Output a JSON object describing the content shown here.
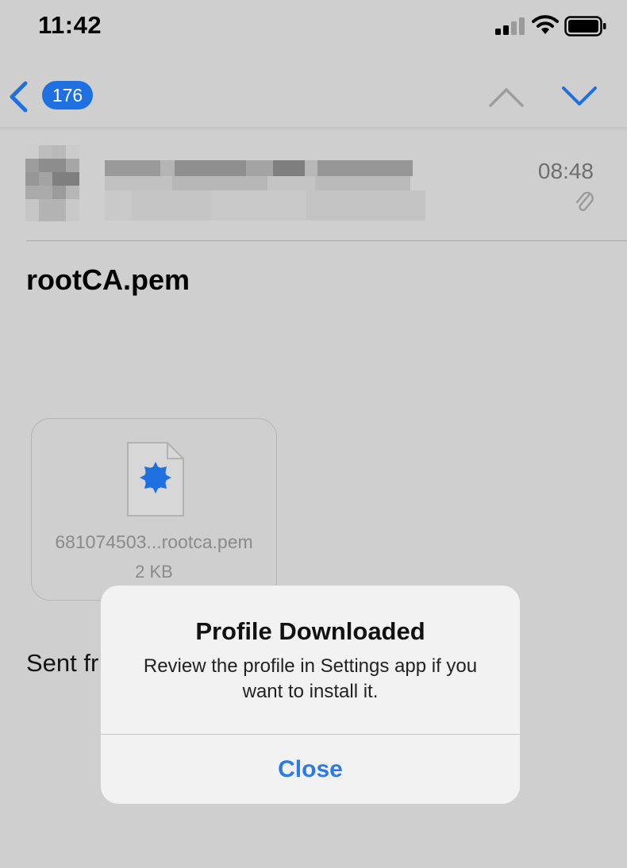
{
  "status_bar": {
    "time": "11:42",
    "icons": [
      "cellular-signal-icon",
      "wifi-icon",
      "battery-icon"
    ]
  },
  "nav": {
    "unread_count": "176",
    "icons": [
      "back-chevron-icon",
      "previous-message-icon",
      "next-message-icon"
    ],
    "accent_color": "#1e6fe0"
  },
  "message": {
    "time": "08:48",
    "subject": "rootCA.pem",
    "attachment": {
      "file_name": "681074503...rootca.pem",
      "file_size": "2 KB",
      "icon": "certificate-file-icon"
    },
    "body_text": "Sent fr"
  },
  "alert": {
    "title": "Profile Downloaded",
    "message": "Review the profile in Settings app if you want to install it.",
    "button_label": "Close",
    "button_color": "#2c7be5"
  }
}
